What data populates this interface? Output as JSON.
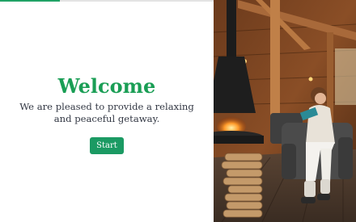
{
  "progress": {
    "fraction": 0.28
  },
  "welcome": {
    "title": "Welcome",
    "subtitle": "We are pleased to provide a relaxing and peaceful getaway.",
    "start_label": "Start"
  },
  "colors": {
    "accent": "#1a9e55",
    "button": "#1b9a63",
    "text": "#333844"
  },
  "photo": {
    "subject": "cabin-interior-photo"
  }
}
